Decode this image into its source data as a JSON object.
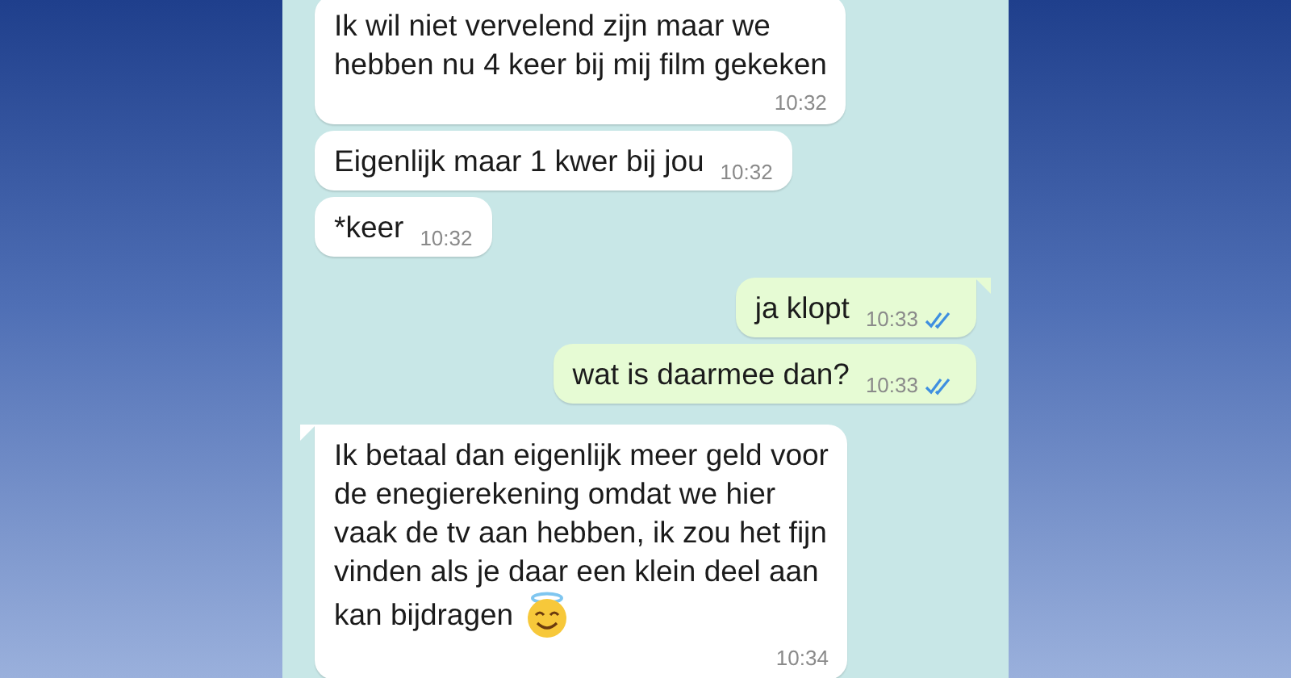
{
  "messages": [
    {
      "kind": "incoming",
      "lines": [
        "Ik wil niet vervelend zijn maar we",
        "hebben nu 4 keer bij mij film gekeken"
      ],
      "time": "10:32"
    },
    {
      "kind": "incoming",
      "lines": [
        "Eigenlijk maar 1 kwer bij jou"
      ],
      "time": "10:32"
    },
    {
      "kind": "incoming",
      "lines": [
        "*keer"
      ],
      "time": "10:32"
    },
    {
      "kind": "outgoing",
      "tail": true,
      "lines": [
        "ja klopt"
      ],
      "time": "10:33",
      "read": true
    },
    {
      "kind": "outgoing",
      "lines": [
        "wat is daarmee dan?"
      ],
      "time": "10:33",
      "read": true
    },
    {
      "kind": "incoming",
      "tail": true,
      "lines": [
        "Ik betaal dan eigenlijk meer geld voor",
        "de enegierekening omdat we hier",
        "vaak de tv aan hebben, ik zou het fijn",
        "vinden als je daar een klein deel aan",
        "kan bijdragen"
      ],
      "time": "10:34",
      "emoji": {
        "kind": "halo-smiley"
      }
    }
  ]
}
